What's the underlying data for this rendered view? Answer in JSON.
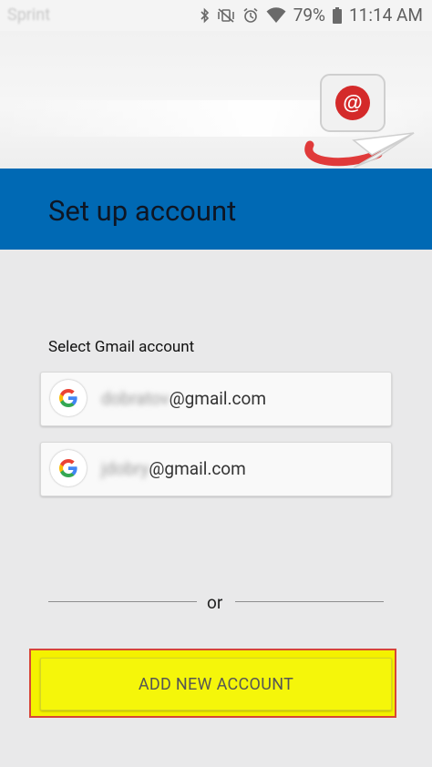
{
  "status_bar": {
    "carrier": "Sprint",
    "battery": "79%",
    "time": "11:14 AM"
  },
  "header": {
    "title": "Set up account",
    "colors": {
      "title_bar": "#0069b4",
      "logo_red": "#d42a2a"
    }
  },
  "accounts": {
    "label": "Select Gmail account",
    "items": [
      {
        "user_redacted": "dobratov",
        "domain": "@gmail.com"
      },
      {
        "user_redacted": "jdobry",
        "domain": "@gmail.com"
      }
    ]
  },
  "divider": {
    "text": "or"
  },
  "actions": {
    "add_label": "ADD NEW ACCOUNT",
    "highlight_color": "#f4f100"
  }
}
